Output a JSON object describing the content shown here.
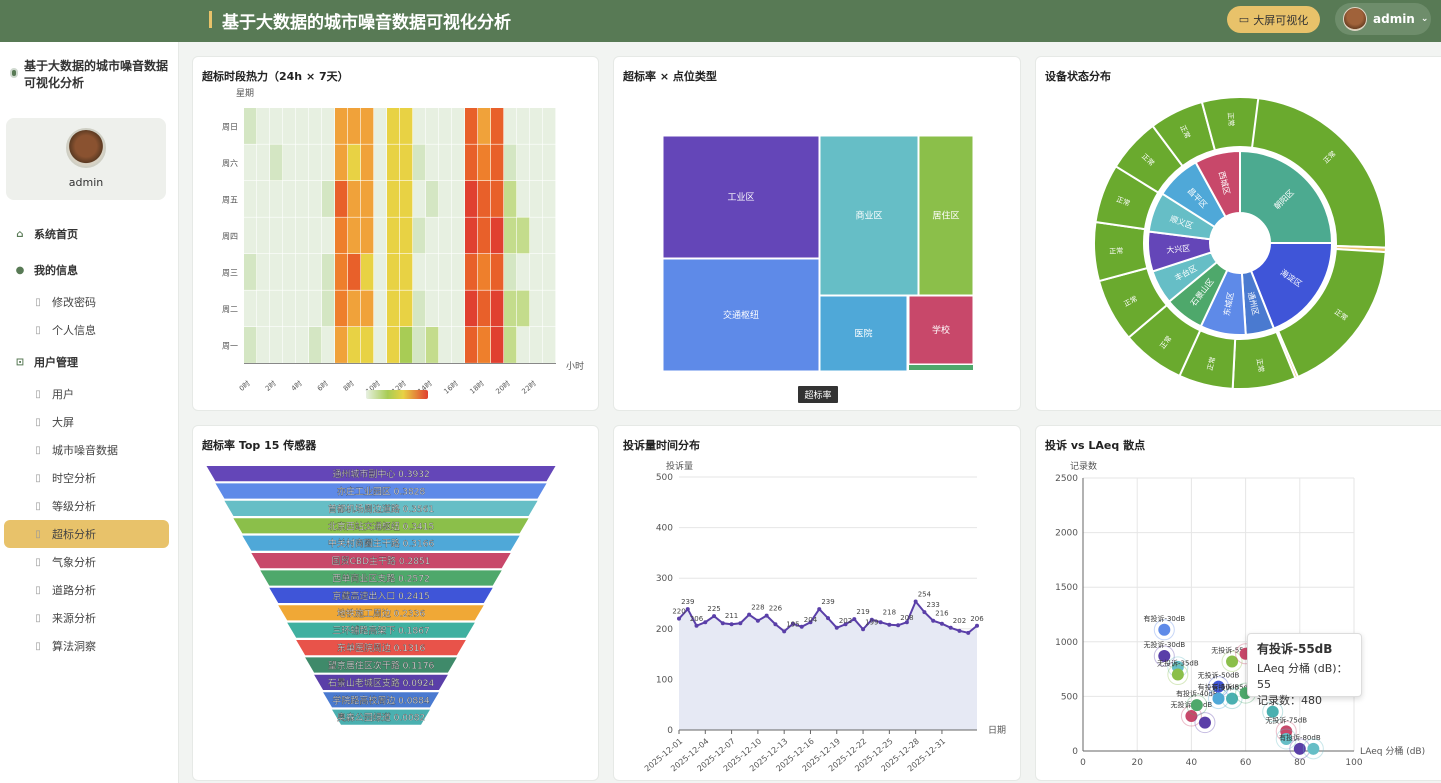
{
  "header": {
    "title": "基于大数据的城市噪音数据可视化分析",
    "screen_button": "大屏可视化",
    "user": "admin"
  },
  "sidebar": {
    "brand": "基于大数据的城市噪音数据可视化分析",
    "username": "admin",
    "items": [
      {
        "label": "系统首页",
        "type": "section",
        "icon": "home-icon"
      },
      {
        "label": "我的信息",
        "type": "section",
        "icon": "user-icon"
      },
      {
        "label": "修改密码",
        "type": "sub",
        "icon": "lock-icon"
      },
      {
        "label": "个人信息",
        "type": "sub",
        "icon": "person-icon"
      },
      {
        "label": "用户管理",
        "type": "section",
        "icon": "dashboard-icon"
      },
      {
        "label": "用户",
        "type": "sub",
        "icon": "doc-icon"
      },
      {
        "label": "大屏",
        "type": "sub",
        "icon": "doc-icon"
      },
      {
        "label": "城市噪音数据",
        "type": "sub",
        "icon": "doc-icon"
      },
      {
        "label": "时空分析",
        "type": "sub",
        "icon": "doc-icon"
      },
      {
        "label": "等级分析",
        "type": "sub",
        "icon": "doc-icon"
      },
      {
        "label": "超标分析",
        "type": "sub",
        "icon": "doc-icon",
        "active": true
      },
      {
        "label": "气象分析",
        "type": "sub",
        "icon": "doc-icon"
      },
      {
        "label": "道路分析",
        "type": "sub",
        "icon": "doc-icon"
      },
      {
        "label": "来源分析",
        "type": "sub",
        "icon": "doc-icon"
      },
      {
        "label": "算法洞察",
        "type": "sub",
        "icon": "doc-icon"
      }
    ]
  },
  "cards": {
    "heatmap_title": "超标时段热力（24h × 7天）",
    "treemap_title": "超标率 × 点位类型",
    "sunburst_title": "设备状态分布",
    "funnel_title": "超标率 Top 15 传感器",
    "line_title": "投诉量时间分布",
    "scatter_title": "投诉 vs LAeq 散点"
  },
  "tooltip": {
    "title": "有投诉-55dB",
    "line1": "LAeq 分桶 (dB)：55",
    "line2": "记录数：480"
  },
  "chart_data": [
    {
      "type": "heatmap",
      "title": "超标时段热力（24h × 7天）",
      "ylabel": "星期",
      "xlabel": "小时",
      "y_categories": [
        "周一",
        "周二",
        "周三",
        "周四",
        "周五",
        "周六",
        "周日"
      ],
      "x_tick_labels": [
        "0时",
        "2时",
        "4时",
        "6时",
        "8时",
        "10时",
        "12时",
        "14时",
        "16时",
        "18时",
        "20时",
        "22时"
      ],
      "values": [
        [
          2,
          1,
          1,
          1,
          1,
          2,
          1,
          10,
          8,
          9,
          1,
          9,
          6,
          2,
          3,
          1,
          1,
          13,
          12,
          14,
          4,
          1,
          1,
          1
        ],
        [
          1,
          1,
          1,
          1,
          1,
          1,
          2,
          12,
          11,
          10,
          1,
          8,
          9,
          2,
          1,
          1,
          1,
          14,
          13,
          14,
          3,
          4,
          1,
          1
        ],
        [
          2,
          1,
          1,
          1,
          1,
          1,
          2,
          12,
          13,
          9,
          1,
          9,
          8,
          1,
          1,
          1,
          1,
          13,
          12,
          13,
          2,
          1,
          1,
          1
        ],
        [
          1,
          1,
          1,
          1,
          1,
          1,
          1,
          12,
          11,
          11,
          1,
          8,
          8,
          2,
          1,
          1,
          1,
          14,
          13,
          14,
          3,
          3,
          1,
          1
        ],
        [
          1,
          1,
          1,
          1,
          1,
          1,
          2,
          13,
          11,
          10,
          1,
          9,
          9,
          1,
          2,
          1,
          1,
          14,
          13,
          13,
          3,
          1,
          1,
          1
        ],
        [
          1,
          1,
          2,
          1,
          1,
          1,
          1,
          10,
          9,
          11,
          1,
          9,
          9,
          2,
          1,
          1,
          1,
          13,
          12,
          13,
          2,
          1,
          1,
          1
        ],
        [
          2,
          1,
          1,
          1,
          1,
          1,
          1,
          10,
          11,
          10,
          1,
          8,
          8,
          1,
          1,
          1,
          1,
          13,
          11,
          13,
          1,
          1,
          1,
          1
        ]
      ],
      "value_range": [
        0,
        15
      ]
    },
    {
      "type": "treemap",
      "title": "超标率 × 点位类型",
      "breadcrumb": "超标率",
      "items": [
        {
          "name": "工业区",
          "color": "#6446b8"
        },
        {
          "name": "交通枢纽",
          "color": "#5e8ae8"
        },
        {
          "name": "商业区",
          "color": "#66bec6"
        },
        {
          "name": "居住区",
          "color": "#8bbf4a"
        },
        {
          "name": "医院",
          "color": "#4fa8d8"
        },
        {
          "name": "学校",
          "color": "#c8486a"
        }
      ]
    },
    {
      "type": "sunburst",
      "title": "设备状态分布",
      "inner_rings": [
        "朝阳区",
        "海淀区",
        "通州区",
        "东城区",
        "石景山区",
        "丰台区",
        "大兴区",
        "顺义区",
        "昌平区",
        "西城区"
      ],
      "outer_label": "正常"
    },
    {
      "type": "funnel",
      "title": "超标率 Top 15 传感器",
      "items": [
        {
          "name": "通州城市副中心",
          "value": 0.3932,
          "color": "#6446b8"
        },
        {
          "name": "亦庄工业园区",
          "value": 0.3828,
          "color": "#5e8ae8"
        },
        {
          "name": "首都机场周边道路",
          "value": 0.3561,
          "color": "#66bec6"
        },
        {
          "name": "北京西站交通枢纽",
          "value": 0.3415,
          "color": "#8bbf4a"
        },
        {
          "name": "中关村商圈主干路",
          "value": 0.3166,
          "color": "#4fa8d8"
        },
        {
          "name": "国贸CBD主干路",
          "value": 0.2851,
          "color": "#c8486a"
        },
        {
          "name": "西单商业区支路",
          "value": 0.2572,
          "color": "#4ea86b"
        },
        {
          "name": "京藏高速出入口",
          "value": 0.2415,
          "color": "#3f55d8"
        },
        {
          "name": "地铁施工周边",
          "value": 0.2336,
          "color": "#f0a836"
        },
        {
          "name": "三环辅路高架下",
          "value": 0.1867,
          "color": "#3fb0a0"
        },
        {
          "name": "东单医院周边",
          "value": 0.1316,
          "color": "#e8534a"
        },
        {
          "name": "望京居住区次干路",
          "value": 0.1176,
          "color": "#3f8a6a"
        },
        {
          "name": "石景山老城区支路",
          "value": 0.0924,
          "color": "#5a3fa8"
        },
        {
          "name": "学院路高校周边",
          "value": 0.0884,
          "color": "#4a7ad0"
        },
        {
          "name": "奥森公园绿道",
          "value": 0.0082,
          "color": "#4ab0b0"
        }
      ]
    },
    {
      "type": "area",
      "title": "投诉量时间分布",
      "ylabel": "投诉量",
      "xlabel": "日期",
      "ylim": [
        0,
        500
      ],
      "y_ticks": [
        0,
        100,
        200,
        300,
        400,
        500
      ],
      "x_tick_labels": [
        "2025-12-01",
        "2025-12-04",
        "2025-12-07",
        "2025-12-10",
        "2025-12-13",
        "2025-12-16",
        "2025-12-19",
        "2025-12-22",
        "2025-12-25",
        "2025-12-28",
        "2025-12-31"
      ],
      "values": [
        220,
        239,
        206,
        213,
        225,
        211,
        209,
        211,
        228,
        216,
        226,
        209,
        195,
        210,
        204,
        213,
        239,
        221,
        202,
        209,
        219,
        199,
        218,
        213,
        208,
        207,
        213,
        254,
        233,
        216,
        210,
        202,
        196,
        192,
        206
      ],
      "data_labels": [
        {
          "i": 0,
          "v": 220
        },
        {
          "i": 1,
          "v": 239
        },
        {
          "i": 2,
          "v": 206
        },
        {
          "i": 4,
          "v": 225
        },
        {
          "i": 6,
          "v": 211
        },
        {
          "i": 9,
          "v": 228
        },
        {
          "i": 11,
          "v": 226
        },
        {
          "i": 13,
          "v": 195
        },
        {
          "i": 15,
          "v": 204
        },
        {
          "i": 17,
          "v": 239
        },
        {
          "i": 19,
          "v": 202
        },
        {
          "i": 21,
          "v": 219
        },
        {
          "i": 22,
          "v": 199
        },
        {
          "i": 24,
          "v": 218
        },
        {
          "i": 26,
          "v": 208
        },
        {
          "i": 28,
          "v": 254
        },
        {
          "i": 29,
          "v": 233
        },
        {
          "i": 30,
          "v": 216
        },
        {
          "i": 32,
          "v": 202
        },
        {
          "i": 34,
          "v": 206
        }
      ]
    },
    {
      "type": "scatter",
      "title": "投诉 vs LAeq 散点",
      "ylabel": "记录数",
      "xlabel": "LAeq 分桶 (dB)",
      "xlim": [
        0,
        100
      ],
      "ylim": [
        0,
        2500
      ],
      "x_ticks": [
        0,
        20,
        40,
        60,
        80,
        100
      ],
      "y_ticks": [
        0,
        500,
        1000,
        1500,
        2000,
        2500
      ],
      "points": [
        {
          "x": 30,
          "y": 1110,
          "label": "有投诉-30dB",
          "color": "#5e8ae8"
        },
        {
          "x": 30,
          "y": 870,
          "label": "无投诉-30dB",
          "color": "#5a3fa8"
        },
        {
          "x": 35,
          "y": 770,
          "label": "",
          "color": "#66bec6"
        },
        {
          "x": 35,
          "y": 700,
          "label": "无投诉-35dB",
          "color": "#8bbf4a"
        },
        {
          "x": 40,
          "y": 320,
          "label": "无投诉-40dB",
          "color": "#c8486a"
        },
        {
          "x": 42,
          "y": 420,
          "label": "有投诉-40dB",
          "color": "#4ea86b"
        },
        {
          "x": 45,
          "y": 260,
          "label": "",
          "color": "#5a3fa8"
        },
        {
          "x": 50,
          "y": 590,
          "label": "无投诉-50dB",
          "color": "#3f55d8"
        },
        {
          "x": 50,
          "y": 480,
          "label": "有投诉-50dB",
          "color": "#4fa8d8"
        },
        {
          "x": 55,
          "y": 820,
          "label": "无投诉-55dB",
          "color": "#8bbf4a"
        },
        {
          "x": 55,
          "y": 480,
          "label": "有投诉-55dB",
          "color": "#4ab0b0"
        },
        {
          "x": 60,
          "y": 530,
          "label": "",
          "color": "#4ea86b"
        },
        {
          "x": 60,
          "y": 890,
          "label": "",
          "color": "#c8486a"
        },
        {
          "x": 70,
          "y": 360,
          "label": "",
          "color": "#4ab0b0"
        },
        {
          "x": 75,
          "y": 180,
          "label": "无投诉-75dB",
          "color": "#c8486a"
        },
        {
          "x": 75,
          "y": 110,
          "label": "",
          "color": "#66bec6"
        },
        {
          "x": 80,
          "y": 20,
          "label": "有投诉-80dB",
          "color": "#5a3fa8"
        },
        {
          "x": 85,
          "y": 20,
          "label": "",
          "color": "#66bec6"
        }
      ]
    }
  ]
}
